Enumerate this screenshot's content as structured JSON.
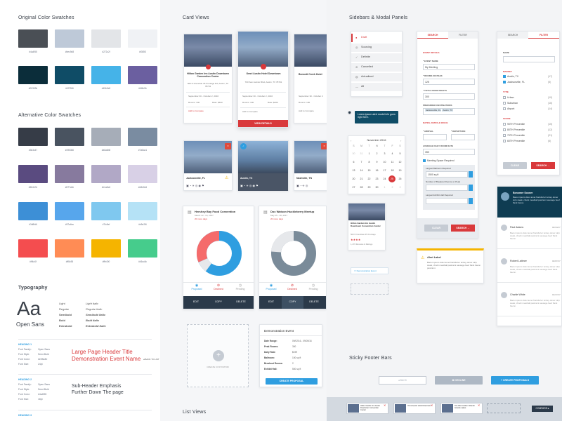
{
  "col1": {
    "original_title": "Original Color Swatches",
    "alt_title": "Alternative Color Swatches",
    "typo_title": "Typography",
    "orig_swatches": [
      [
        "#4a4f55",
        "#4a4f55"
      ],
      [
        "#bec9d8",
        "#bec9d8"
      ],
      [
        "#e3e5e8",
        "#272c2f"
      ],
      [
        "#f0f2f5",
        "#f3f3f3"
      ],
      [
        "#0b2d3a",
        "#00303b"
      ],
      [
        "#0f4c66",
        "#0f7266"
      ],
      [
        "#45b3e8",
        "#45b3e8"
      ],
      [
        "#6b5fa0",
        "#6f4b9b"
      ]
    ],
    "alt_swatches": [
      [
        "#363c47",
        "#363c47"
      ],
      [
        "#495360",
        "#495360"
      ],
      [
        "#a6adb8",
        "#a6adb8"
      ],
      [
        "#7a8ca1",
        "#7a8ca1"
      ],
      [
        "#5a4b80",
        "#584b7d"
      ],
      [
        "#877a9e",
        "#877a9e"
      ],
      [
        "#b1a8c6",
        "#b1a8c6"
      ],
      [
        "#d8d0e6",
        "#d8d0e6"
      ],
      [
        "#3d8fd6",
        "#3d8fd6"
      ],
      [
        "#57a6ec",
        "#57a6ec"
      ],
      [
        "#7fc8ef",
        "#7fc8ef"
      ],
      [
        "#b5e2f6",
        "#b5e2f6"
      ],
      [
        "#f44d4f",
        "#ff4d4f"
      ],
      [
        "#ff8c55",
        "#ff8c55"
      ],
      [
        "#f5b400",
        "#ffb400"
      ],
      [
        "#46cc8c",
        "#46cc8c"
      ]
    ],
    "aa": "Aa",
    "font_name": "Open Sans",
    "weights_left": [
      "Light",
      "Regular",
      "Semibold",
      "Bold",
      "Extrabold"
    ],
    "weights_right": [
      "Light Italic",
      "Regular Italic",
      "Semibold Italic",
      "Bold Italic",
      "Extrabold Italic"
    ],
    "h1_label": "HEADING 1",
    "h1_specs": [
      [
        "Font Family:",
        "Open Sans"
      ],
      [
        "Font Style:",
        "Semi-Bold"
      ],
      [
        "Font Color:",
        "#e05a3b"
      ],
      [
        "Font Size:",
        "24pt"
      ]
    ],
    "h1_line1": "Large Page Header Title",
    "h1_line2": "Demonstration Event Name",
    "back_link": "◂ BACK TO LIST",
    "h2_label": "HEADING 2",
    "h2_specs": [
      [
        "Font Family:",
        "Open Sans"
      ],
      [
        "Font Style:",
        "Semi-Bold"
      ],
      [
        "Font Color:",
        "#4a4f55"
      ],
      [
        "Font Size:",
        "18pt"
      ]
    ],
    "h2_line1": "Sub-Header Emphasis",
    "h2_line2": "Further Down The page",
    "h3_label": "HEADING 3"
  },
  "col2": {
    "title": "Card Views",
    "cards": [
      {
        "name": "Hilton Garden Inn Austin Downtown Convention Center",
        "addr": "500 N Interstate 35 Frontage Rd, Austin, TX 78701",
        "date": "September 30 - October 2, 2016",
        "rooms": "Rooms: 100",
        "rate": "Rate: $400",
        "compare": "Add to Compare"
      },
      {
        "name": "Omni Austin Hotel Downtown",
        "addr": "700 San Jacinto Blvd, Austin, TX 78701",
        "date": "September 30 - October 2, 2016",
        "rooms": "Rooms: 100",
        "rate": "Rate: $400",
        "compare": "Add to Compare",
        "details": "VIEW DETAILS"
      },
      {
        "name": "Bonnett Creek Hotel",
        "addr": "",
        "date": "September 30 - October 2",
        "rooms": "Rooms: 100",
        "rate": "Rate: $300",
        "compare": "Add to Compare"
      }
    ],
    "small_cards": [
      {
        "city": "Jacksonville, FL"
      },
      {
        "city": "Austin, TX"
      },
      {
        "city": "Nashville, TN"
      }
    ],
    "events": [
      {
        "name": "Hershey Bay Food Convention",
        "date": "March 13 - 14, 2017",
        "days": "20 more days",
        "tabs": [
          "Proposed",
          "Declined",
          "Pending"
        ]
      },
      {
        "name": "Doc Watson Huckleberry Meetup",
        "date": "May 15 - 18, 2017",
        "days": "20 more days",
        "tabs": [
          "Proposed",
          "Declined",
          "Pending"
        ]
      }
    ],
    "actions": [
      "EDIT",
      "COPY",
      "DELETE"
    ],
    "create_label": "CREATE CUSTOM BID",
    "demo": {
      "title": "Demonstration Event",
      "rows": [
        [
          "Date Range:",
          "09/02/16 - 09/05/16"
        ],
        [
          "Peak Rooms:",
          "300"
        ],
        [
          "Daily Rate:",
          "$199"
        ],
        [
          "Ballroom:",
          "100 sq ft"
        ],
        [
          "Breakout Rooms:",
          "2"
        ],
        [
          "Exhibit Hall:",
          "500 sq ft"
        ]
      ],
      "button": "CREATE PROPOSAL"
    },
    "list_title": "List Views"
  },
  "col3": {
    "title": "Sidebars & Modal Panels",
    "status_list": [
      "Draft",
      "Sourcing",
      "Definite",
      "Cancelled",
      "Actualized",
      "All"
    ],
    "tooltip": "Lorem ipsum alert model info goes right here.",
    "calendar": {
      "month": "November 2016",
      "days": [
        "S",
        "M",
        "T",
        "W",
        "T",
        "F",
        "S"
      ],
      "rows": [
        [
          "30",
          "31",
          "1",
          "2",
          "3",
          "4",
          "5"
        ],
        [
          "6",
          "7",
          "8",
          "9",
          "10",
          "11",
          "12"
        ],
        [
          "13",
          "14",
          "15",
          "16",
          "17",
          "18",
          "19"
        ],
        [
          "20",
          "21",
          "22",
          "23",
          "24",
          "25",
          "26"
        ],
        [
          "27",
          "28",
          "29",
          "30",
          "1",
          "2",
          "3"
        ]
      ],
      "selected": "25"
    },
    "mini_card": {
      "name": "Hilton Garden Inn Austin Downtown Convention Center",
      "addr": "500 N Interstate 35 Frontage",
      "stars": "★★★★",
      "reviews": "1,476 Reviews & Ratings"
    },
    "demo_event": "Demonstration Event",
    "form": {
      "tab_search": "SEARCH",
      "tab_filter": "FILTER",
      "section1": "EVENT DETAILS",
      "event_name_lbl": "* EVENT NAME",
      "event_name": "My Meeting",
      "peak_lbl": "* ROOMS ON PEAK",
      "peak": "125",
      "total_lbl": "* TOTAL ROOM NIGHTS",
      "total": "300",
      "pref_lbl": "PREFERRED DESTINATIONS",
      "chips": [
        "Jacksonville, FL",
        "Austin, TX"
      ],
      "section2": "DATES, RATES & SPACE",
      "arrival_lbl": "* ARRIVAL",
      "departure_lbl": "* DEPARTURE",
      "avg_lbl": "AVERAGE DAILY ROOM RATE",
      "avg": "350",
      "meeting_lbl": "Meeting Space Required",
      "largest_lbl": "Largest Ballroom Required",
      "largest": "1500 sq ft",
      "breakout_lbl": "Number of Breakout Rooms on Peak",
      "exhibit_lbl": "Largest Exhibit Hall Required",
      "clear": "CLEAR",
      "search": "SEARCH →"
    },
    "filter": {
      "tab_search": "SEARCH",
      "tab_filter": "FILTER",
      "name_lbl": "NAME",
      "market_lbl": "MARKET",
      "markets": [
        [
          "Austin, TX",
          "(17)"
        ],
        [
          "Jacksonville, FL",
          "(5)"
        ]
      ],
      "type_lbl": "TYPE",
      "types": [
        [
          "Urban",
          "(10)"
        ],
        [
          "Suburban",
          "(16)"
        ],
        [
          "Airport",
          "(14)"
        ]
      ],
      "score_lbl": "SCORE",
      "scores": [
        [
          "90TH Percentile",
          "(15)"
        ],
        [
          "80TH Percentile",
          "(12)"
        ],
        [
          "70TH Percentile",
          "(21)"
        ],
        [
          "60TH Percentile",
          "(6)"
        ]
      ],
      "clear": "CLEAR",
      "search": "SEARCH →"
    },
    "chat": {
      "name": "Bonomer Sooner",
      "text": "Bacon ipsum dolor amet frankfurter turkey doner strip steak, chuck meatball pastrami sausage beef flank bacon.",
      "people": [
        [
          "Paul Adams",
          "02/14/17"
        ],
        [
          "Robert Latimer",
          "02/07/17"
        ],
        [
          "Charlie White",
          "01/17/17"
        ]
      ],
      "snippet": "Bacon ipsum dolor amet frankfurter turkey doner strip steak, chuck meatball pastrami sausage beef flank bacon."
    },
    "alert": {
      "title": "Alert Label",
      "text": "Bacon ipsum dolor amet frankfurter turkey doner strip steak, chuck meatball pastrami sausage beef flank bacon pastrami."
    },
    "footer_title": "Sticky Footer Bars",
    "footer": {
      "back": "◂ BACK",
      "decline": "✖ DECLINE",
      "create": "+ CREATE PROPOSALS",
      "compare": "COMPARE ▸",
      "items": [
        "Hilton Garden Inn Austin Downtown Convention Center",
        "Omni Austin Hotel Downtown",
        "The Ritz-Carlton Orlando Grande Lakes"
      ]
    }
  }
}
